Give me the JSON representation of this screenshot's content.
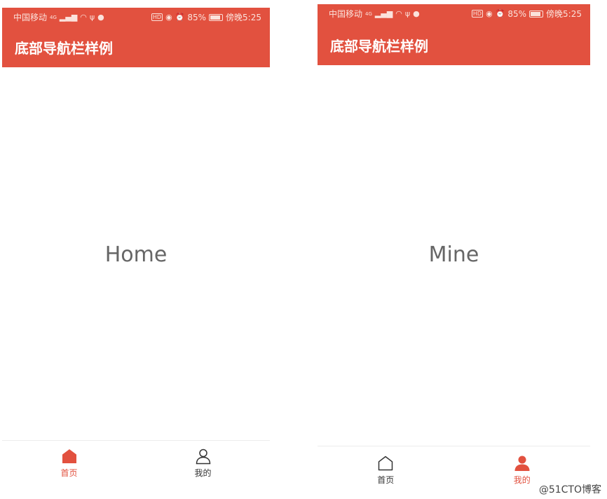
{
  "colors": {
    "primary": "#e2513f",
    "text_gray": "#666666",
    "nav_inactive": "#333333"
  },
  "screens": [
    {
      "status": {
        "carrier": "中国移动",
        "signal": "4G",
        "battery": "85%",
        "battery_level": 0.85,
        "time": "傍晚5:25"
      },
      "title": "底部导航栏样例",
      "content": "Home",
      "nav": [
        {
          "label": "首页",
          "icon": "home-icon",
          "active": true
        },
        {
          "label": "我的",
          "icon": "person-icon",
          "active": false
        }
      ]
    },
    {
      "status": {
        "carrier": "中国移动",
        "signal": "4G",
        "battery": "85%",
        "battery_level": 0.85,
        "time": "傍晚5:25"
      },
      "title": "底部导航栏样例",
      "content": "Mine",
      "nav": [
        {
          "label": "首页",
          "icon": "home-icon",
          "active": false
        },
        {
          "label": "我的",
          "icon": "person-icon",
          "active": true
        }
      ]
    }
  ],
  "watermark": "@51CTO博客"
}
